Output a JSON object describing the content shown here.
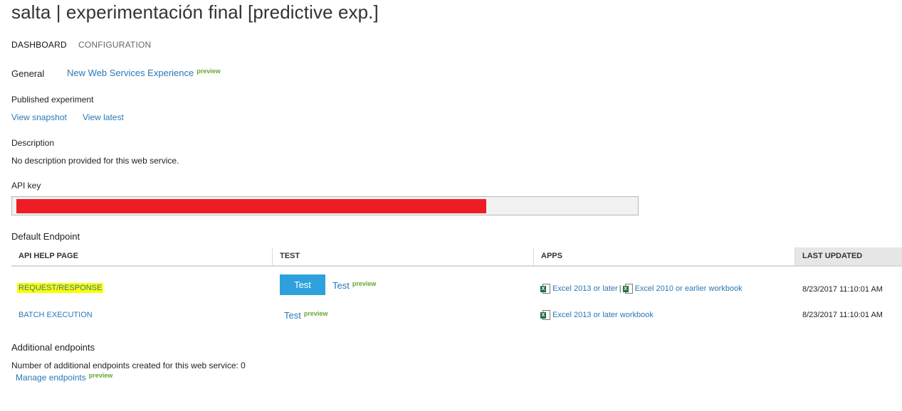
{
  "header": {
    "title": "salta | experimentación final [predictive exp.]",
    "tabs": [
      {
        "label": "DASHBOARD"
      },
      {
        "label": "CONFIGURATION"
      }
    ]
  },
  "general": {
    "label": "General",
    "link": "New Web Services Experience",
    "preview": "preview"
  },
  "published": {
    "label": "Published experiment",
    "view_snapshot": "View snapshot",
    "view_latest": "View latest"
  },
  "description": {
    "label": "Description",
    "text": "No description provided for this web service."
  },
  "api_key": {
    "label": "API key",
    "mask_color": "#ee1c25"
  },
  "default_endpoint": {
    "label": "Default Endpoint",
    "columns": [
      "API HELP PAGE",
      "TEST",
      "APPS",
      "LAST UPDATED"
    ],
    "rows": [
      {
        "api_help": "REQUEST/RESPONSE",
        "test_button": "Test",
        "test_link": "Test",
        "test_preview": "preview",
        "apps": [
          "Excel 2013 or later",
          "Excel 2010 or earlier workbook"
        ],
        "apps_separator": "|",
        "last_updated": "8/23/2017 11:10:01 AM"
      },
      {
        "api_help": "BATCH EXECUTION",
        "test_link": "Test",
        "test_preview": "preview",
        "apps": [
          "Excel 2013 or later workbook"
        ],
        "last_updated": "8/23/2017 11:10:01 AM"
      }
    ]
  },
  "additional": {
    "label": "Additional endpoints",
    "count_text": "Number of additional endpoints created for this web service: 0",
    "manage": "Manage endpoints",
    "preview": "preview"
  },
  "icons": {
    "excel": "excel-file-icon"
  },
  "colors": {
    "link": "#2b78b4",
    "preview": "#67a630",
    "button": "#2ea1dd",
    "highlight": "#ffff00"
  }
}
